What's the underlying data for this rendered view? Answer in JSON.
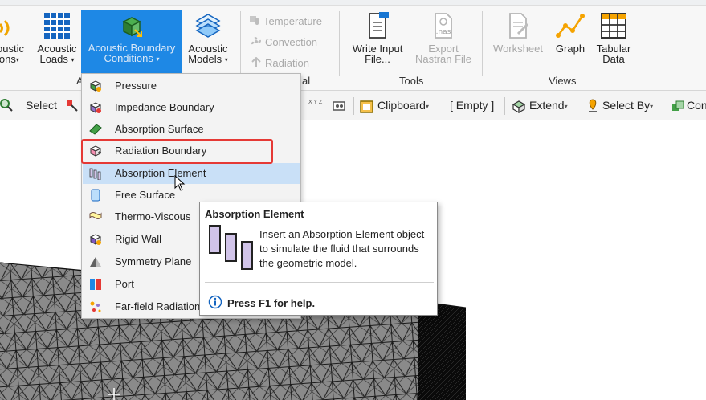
{
  "ribbon": {
    "buttons": [
      {
        "label1": "oustic",
        "label2": "ions",
        "name": "acoustic-excitations-button"
      },
      {
        "label1": "Acoustic",
        "label2": "Loads"
      },
      {
        "label1": "Acoustic Boundary",
        "label2": "Conditions"
      },
      {
        "label1": "Acoustic",
        "label2": "Models"
      }
    ],
    "small_items": [
      "Temperature",
      "Convection",
      "Radiation"
    ],
    "tools": [
      {
        "label1": "Write Input",
        "label2": "File..."
      },
      {
        "label1": "Export",
        "label2": "Nastran File"
      }
    ],
    "nas_badge": ".nas",
    "views": [
      {
        "label": "Worksheet"
      },
      {
        "label": "Graph"
      },
      {
        "label1": "Tabular",
        "label2": "Data"
      }
    ],
    "groups": {
      "left_fragment": "A",
      "middle_fragment": "al",
      "tools": "Tools",
      "views": "Views"
    }
  },
  "toolbar": {
    "select": "Select",
    "xyz": "X Y Z",
    "clipboard": "Clipboard",
    "empty": "[ Empty ]",
    "extend": "Extend",
    "select_by": "Select By",
    "con": "Con"
  },
  "dropdown": {
    "items": [
      {
        "label": "Pressure"
      },
      {
        "label": "Impedance Boundary"
      },
      {
        "label": "Absorption Surface"
      },
      {
        "label": "Radiation Boundary"
      },
      {
        "label": "Absorption Element"
      },
      {
        "label": "Free Surface"
      },
      {
        "label": "Thermo-Viscous"
      },
      {
        "label": "Rigid Wall"
      },
      {
        "label": "Symmetry Plane"
      },
      {
        "label": "Port"
      },
      {
        "label": "Far-field Radiation"
      }
    ],
    "highlighted": "Absorption Element",
    "boxed": "Radiation Boundary"
  },
  "tooltip": {
    "title": "Absorption Element",
    "description": "Insert an Absorption Element object to simulate the fluid that surrounds the geometric model.",
    "help": "Press F1 for help."
  },
  "colors": {
    "accent": "#1e88e5",
    "highlight": "#c9e0f7",
    "redbox": "#e53935",
    "mesh": "#7a7a7a"
  }
}
